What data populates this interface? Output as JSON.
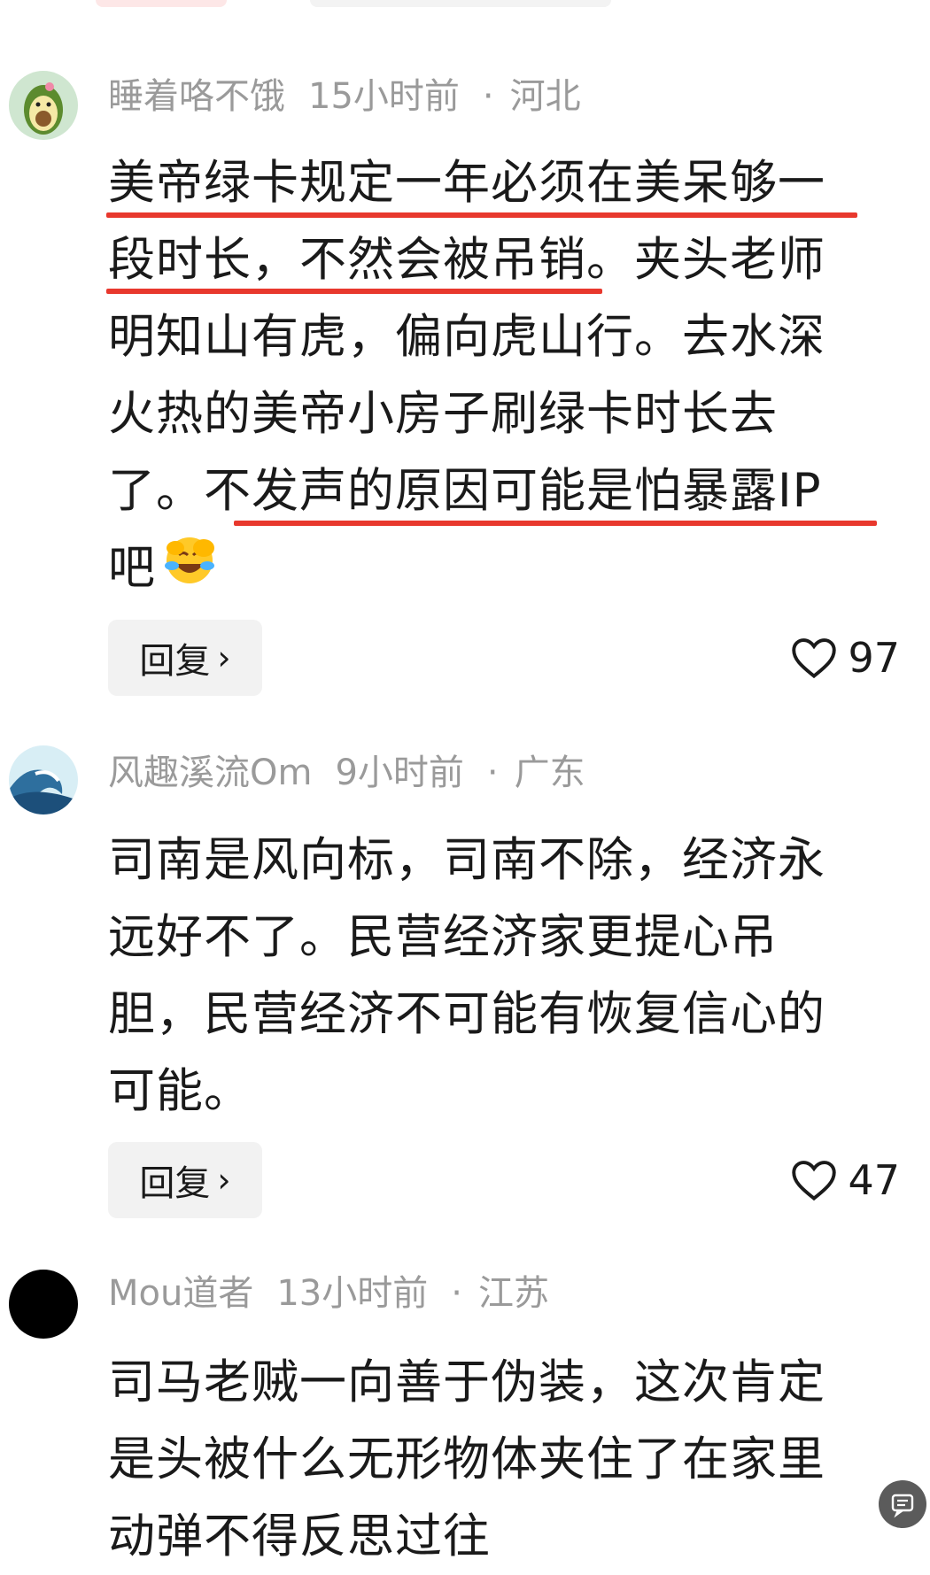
{
  "comments": [
    {
      "user": "睡着咯不饿",
      "time": "15小时前",
      "separator": "·",
      "location": "河北",
      "lines": [
        "美帝绿卡规定一年必须在美呆够一",
        "段时长，不然会被吊销。夹头老师",
        "明知山有虎，偏向虎山行。去水深",
        "火热的美帝小房子刷绿卡时长去",
        "了。不发声的原因可能是怕暴露IP",
        "吧"
      ],
      "emoji": "laughing-crying-emoji",
      "reply_label": "回复",
      "likes": "97"
    },
    {
      "user": "风趣溪流Om",
      "time": "9小时前",
      "separator": "·",
      "location": "广东",
      "lines": [
        "司南是风向标，司南不除，经济永",
        "远好不了。民营经济家更提心吊",
        "胆，民营经济不可能有恢复信心的",
        "可能。"
      ],
      "reply_label": "回复",
      "likes": "47"
    },
    {
      "user": "Mou道者",
      "time": "13小时前",
      "separator": "·",
      "location": "江苏",
      "lines": [
        "司马老贼一向善于伪装，这次肯定",
        "是头被什么无形物体夹住了在家里",
        "动弹不得反思过往"
      ]
    }
  ],
  "colors": {
    "highlight_underline": "#e8382d",
    "meta_text": "#9a9a9a",
    "reply_bg": "#f2f2f2"
  }
}
